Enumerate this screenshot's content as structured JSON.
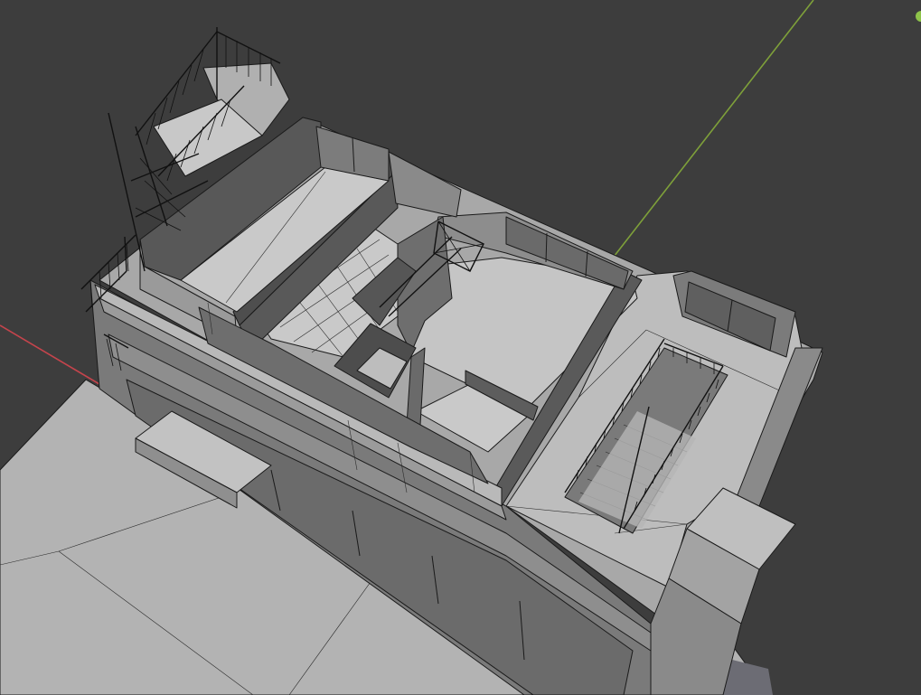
{
  "app": "3D Viewport",
  "view": {
    "mode": "solid-shading",
    "background": "#3d3d3d",
    "axes": {
      "x_axis_color": "#c4444c",
      "y_axis_color": "#7ea03a"
    },
    "gizmo_dot_color": "#8ec34a"
  },
  "scene": {
    "object": "building-model",
    "colors": {
      "roof_light": "#c6c6c6",
      "wall_mid": "#8a8a8a",
      "wall_dark": "#5e5e5e",
      "ground": "#b8b8b8",
      "edge": "#1a1a1a"
    }
  }
}
